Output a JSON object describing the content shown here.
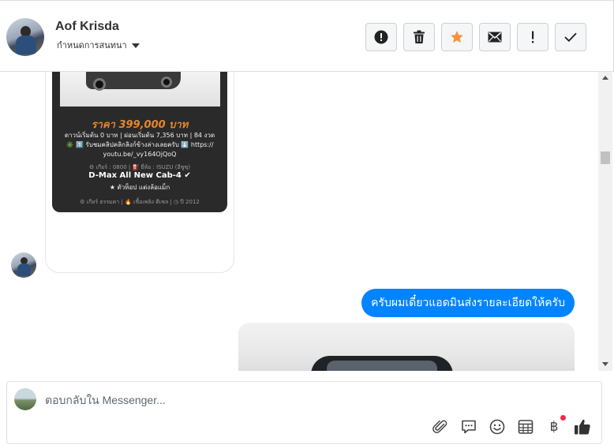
{
  "header": {
    "contact_name": "Aof Krisda",
    "assign_label": "กำหนดการสนทนา",
    "actions": [
      {
        "name": "mark-spam-button",
        "icon": "alert-circle-icon"
      },
      {
        "name": "delete-button",
        "icon": "trash-icon"
      },
      {
        "name": "star-button",
        "icon": "star-icon"
      },
      {
        "name": "mark-unread-button",
        "icon": "envelope-icon"
      },
      {
        "name": "priority-button",
        "icon": "exclamation-icon"
      },
      {
        "name": "mark-done-button",
        "icon": "checkmark-icon"
      }
    ],
    "star_color": "#f7923b"
  },
  "messages": {
    "ad_card": {
      "price": "ราคา 399,000 บาท",
      "line_terms": "ดาวน์เริ่มต้น 0 บาท | ผ่อนเริ่มต้น 7,356 บาท | 84 งวด",
      "line_link": "✳️ 1️⃣ รับชมคลิปคลิกลิงก์ข้างล่างเลยครับ ⬇️ https://",
      "line_url": "youtu.be/_vy164OjQoQ",
      "line_specs": "⚙ เกียร์ : 0800 | ⛽ ยี่ห้อ : ISUZU (อีซูซุ)",
      "model": "D-Max All New Cab-4 ✔",
      "tagline": "★ ตัวท็อป แต่งล้อแม็ก",
      "footer": "⚙ เกียร์ ธรรมดา  |  🔥 เชื้อเพลิง ดีเซล  |  ◷ ปี 2012"
    },
    "outgoing_text": "ครับผมเดี๋ยวแอดมินส่งรายละเอียดให้ครับ",
    "bubble_color": "#0084ff"
  },
  "composer": {
    "placeholder": "ตอบกลับใน Messenger...",
    "tools": [
      {
        "name": "attach-button",
        "icon": "paperclip-icon"
      },
      {
        "name": "saved-replies-button",
        "icon": "chat-bubble-icon"
      },
      {
        "name": "emoji-button",
        "icon": "smiley-icon"
      },
      {
        "name": "appointment-button",
        "icon": "calendar-icon"
      },
      {
        "name": "payment-button",
        "icon": "baht-icon",
        "symbol": "฿"
      },
      {
        "name": "like-button",
        "icon": "thumbs-up-icon"
      }
    ]
  }
}
